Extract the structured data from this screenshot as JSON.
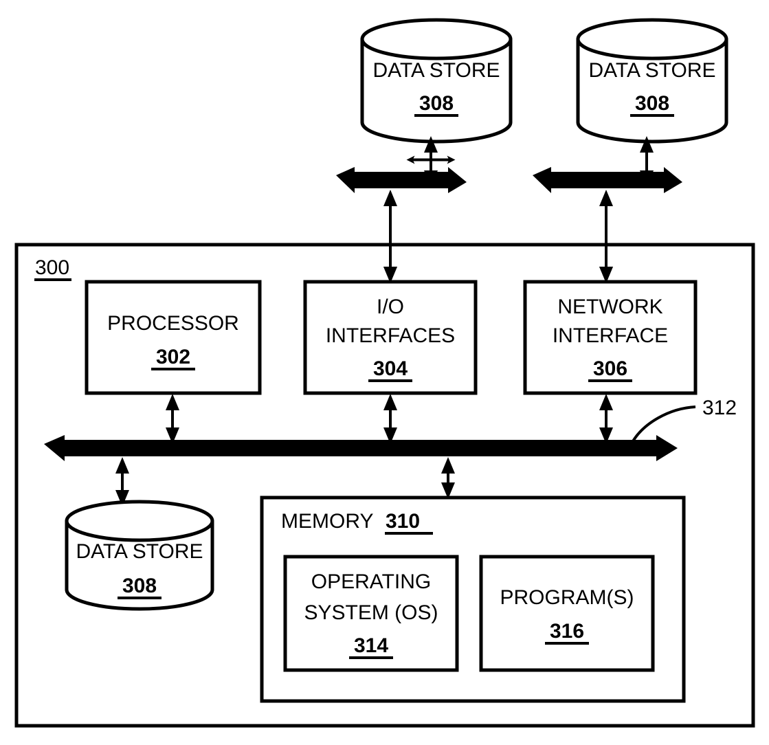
{
  "figure": {
    "type": "computing-system-block-diagram",
    "system_ref": "300"
  },
  "top_data_stores": [
    {
      "label": "DATA STORE",
      "ref": "308"
    },
    {
      "label": "DATA STORE",
      "ref": "308"
    }
  ],
  "components": [
    {
      "line1": "PROCESSOR",
      "line2": "",
      "ref": "302"
    },
    {
      "line1": "I/O",
      "line2": "INTERFACES",
      "ref": "304"
    },
    {
      "line1": "NETWORK",
      "line2": "INTERFACE",
      "ref": "306"
    }
  ],
  "bus": {
    "ref": "312"
  },
  "local_data_store": {
    "label": "DATA STORE",
    "ref": "308"
  },
  "memory": {
    "label": "MEMORY",
    "ref": "310",
    "modules": [
      {
        "line1": "OPERATING",
        "line2": "SYSTEM (OS)",
        "ref": "314"
      },
      {
        "line1": "PROGRAM(S)",
        "line2": "",
        "ref": "316"
      }
    ]
  },
  "colors": {
    "stroke": "#000000",
    "background": "#ffffff"
  }
}
